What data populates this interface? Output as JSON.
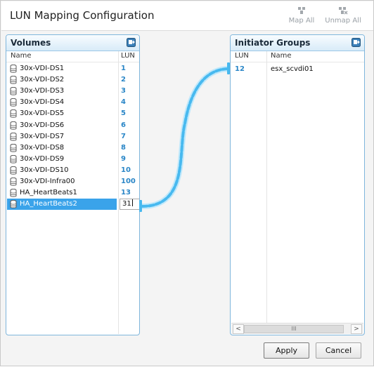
{
  "header": {
    "title": "LUN Mapping Configuration",
    "map_all_label": "Map All",
    "unmap_all_label": "Unmap All",
    "map_icon": "map-all-icon",
    "unmap_icon": "unmap-all-icon"
  },
  "volumes": {
    "title": "Volumes",
    "columns": {
      "name": "Name",
      "lun": "LUN"
    },
    "rows": [
      {
        "name": "30x-VDI-DS1",
        "lun": "1"
      },
      {
        "name": "30x-VDI-DS2",
        "lun": "2"
      },
      {
        "name": "30x-VDI-DS3",
        "lun": "3"
      },
      {
        "name": "30x-VDI-DS4",
        "lun": "4"
      },
      {
        "name": "30x-VDI-DS5",
        "lun": "5"
      },
      {
        "name": "30x-VDI-DS6",
        "lun": "6"
      },
      {
        "name": "30x-VDI-DS7",
        "lun": "7"
      },
      {
        "name": "30x-VDI-DS8",
        "lun": "8"
      },
      {
        "name": "30x-VDI-DS9",
        "lun": "9"
      },
      {
        "name": "30x-VDI-DS10",
        "lun": "10"
      },
      {
        "name": "30x-VDI-Infra00",
        "lun": "100"
      },
      {
        "name": "HA_HeartBeats1",
        "lun": "13"
      },
      {
        "name": "HA_HeartBeats2",
        "lun": "31"
      }
    ]
  },
  "initiator_groups": {
    "title": "Initiator Groups",
    "columns": {
      "lun": "LUN",
      "name": "Name"
    },
    "rows": [
      {
        "lun": "12",
        "name": "esx_scvdi01"
      }
    ],
    "scroll_left": "<",
    "scroll_right": ">",
    "scroll_thumb": "III"
  },
  "footer": {
    "apply_label": "Apply",
    "cancel_label": "Cancel"
  },
  "colors": {
    "accent": "#3aa3ea",
    "lun_text": "#2a86c7",
    "connector": "#5cc3f2"
  }
}
